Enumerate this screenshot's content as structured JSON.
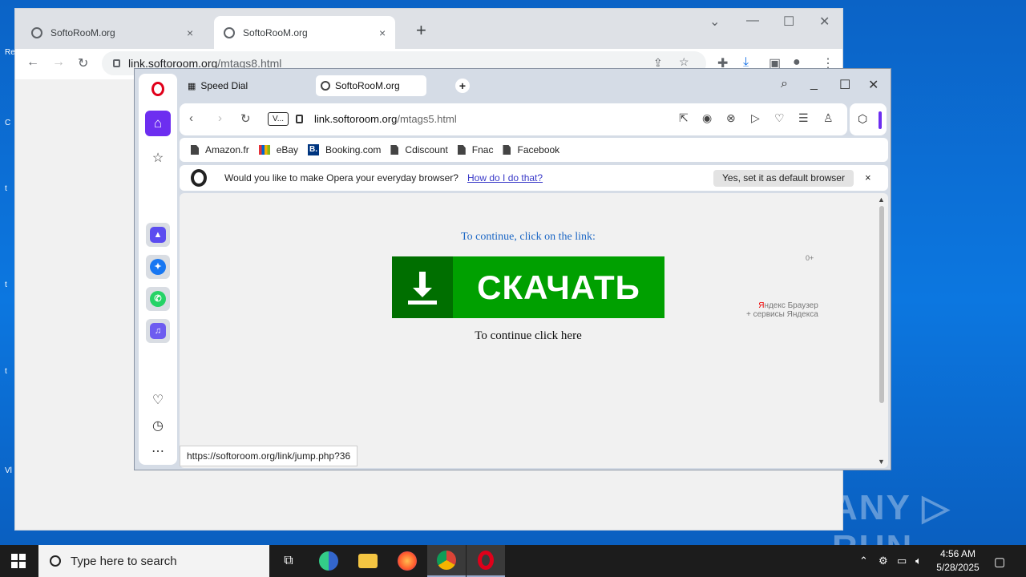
{
  "desktop": {
    "watermark": "ANY ▷ RUN"
  },
  "chrome": {
    "tabs": [
      {
        "label": "SoftoRooM.org"
      },
      {
        "label": "SoftoRooM.org"
      }
    ],
    "new_tab": "+",
    "url_host": "link.softoroom.org",
    "url_path": "/mtags8.html"
  },
  "opera": {
    "tabs": [
      {
        "label": "Speed Dial"
      },
      {
        "label": "SoftoRooM.org"
      }
    ],
    "vpn": "V...",
    "url_host": "link.softoroom.org",
    "url_path": "/mtags5.html",
    "bookmarks": [
      "Amazon.fr",
      "eBay",
      "Booking.com",
      "Cdiscount",
      "Fnac",
      "Facebook"
    ],
    "infobar": {
      "message": "Would you like to make Opera your everyday browser?",
      "link": "How do I do that?",
      "button": "Yes, set it as default browser",
      "close": "×"
    },
    "page": {
      "prompt": "To continue, click on the link:",
      "download_label": "СКАЧАТЬ",
      "continue": "To continue click here",
      "age": "0+",
      "yandex_line1_red": "Я",
      "yandex_line1": "ндекс Браузер",
      "yandex_line2": "+ сервисы Яндекса"
    },
    "status_url": "https://softoroom.org/link/jump.php?36"
  },
  "taskbar": {
    "search_placeholder": "Type here to search",
    "time": "4:56 AM",
    "date": "5/28/2025"
  },
  "colors": {
    "opera_accent": "#6d2ef0",
    "download_green": "#00a000",
    "link_blue": "#1b66c4"
  }
}
